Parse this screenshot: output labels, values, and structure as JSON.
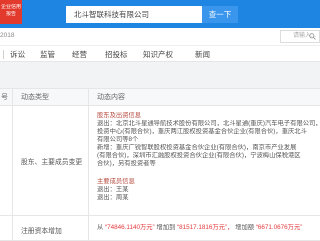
{
  "colors": {
    "accent": "#1e86e2",
    "button": "#3a95ec",
    "highlight": "#e4393c",
    "section": "#b5473a"
  },
  "header": {
    "badge_lines": [
      "企业信用",
      "报告"
    ],
    "search_value": "北斗智联科技有限公司",
    "search_button": "查一下"
  },
  "subbar": {
    "year_text": "2018",
    "search_placeholder": "请输入...",
    "search_icon": "search-icon"
  },
  "tabs": [
    "诉讼",
    "监管",
    "经营",
    "招投标",
    "知识产权",
    "新闻"
  ],
  "table": {
    "headers": {
      "index": "号",
      "type": "动态类型",
      "content": "动态内容"
    },
    "rows": [
      {
        "type": "股东、主要成员变更",
        "shareholder_title": "股东及出资信息",
        "shareholder_lines": [
          "退出：北京北斗星通导航技术股份有限公司，北斗星通(重庆)汽车电子有限公司，",
          "投资中心(有限合伙)，重庆两江股权投资基金合伙企业(有限合伙)，重庆北斗",
          "有限公司等8个",
          "新增：重庆广锐智联股权投资基金合伙企业(有限合伙)，南京市产业发展",
          "(有限合伙)，深圳市汇融股权投资合伙企业(有限合伙)，宁波梅山保税港区",
          "合伙)，另有投资者等"
        ],
        "member_title": "主要成员信息",
        "member_lines": [
          "退出：王某",
          "退出：周某"
        ]
      },
      {
        "type": "注册资本增加",
        "content": {
          "from_label": "从",
          "from_value": "“74846.1140万元”",
          "to_label": "增加到",
          "to_value": "“81517.1816万元”，",
          "diff_label": "增加额",
          "diff_value": "“6671.0676万元”"
        }
      }
    ]
  }
}
